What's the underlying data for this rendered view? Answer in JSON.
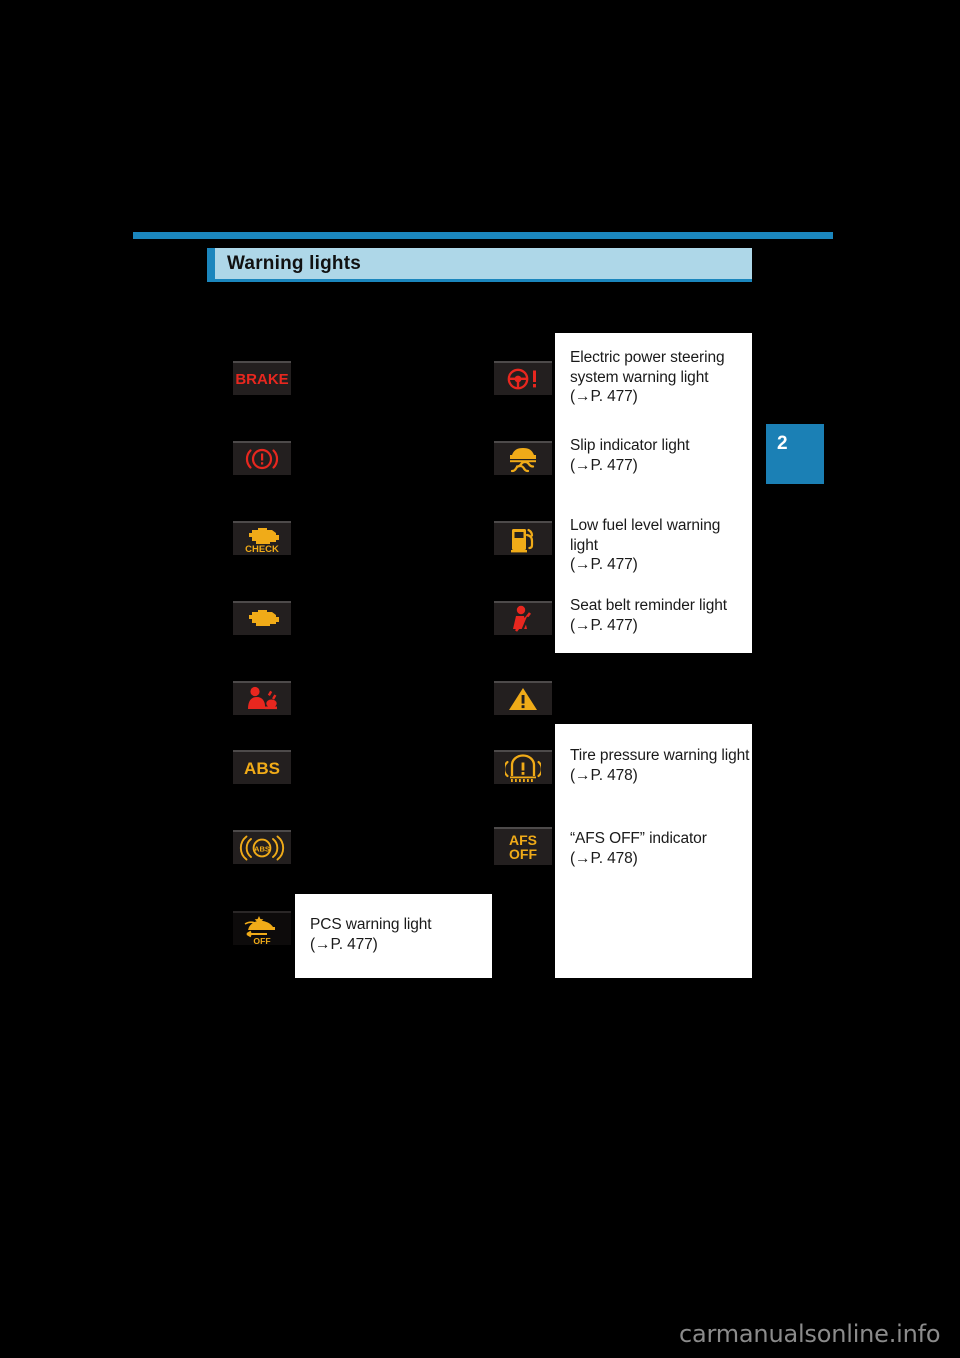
{
  "page": {
    "chapter_number": "2",
    "watermark": "carmanualsonline.info",
    "background_color": "#000000",
    "accent_color": "#1b86bd",
    "header_fill_color": "#aed7e8"
  },
  "section": {
    "title": "Warning lights"
  },
  "left_column": {
    "icons": [
      {
        "id": "brake-warning-light",
        "glyph": "BRAKE",
        "color": "#e8271f"
      },
      {
        "id": "brake-system-warning-light",
        "glyph": "(!)",
        "color": "#e8271f"
      },
      {
        "id": "check-engine-light",
        "glyph": "CHECK",
        "color": "#f0ab18"
      },
      {
        "id": "malfunction-indicator-lamp",
        "glyph": "engine",
        "color": "#f0ab18"
      },
      {
        "id": "srs-airbag-warning-light",
        "glyph": "airbag",
        "color": "#e8271f"
      },
      {
        "id": "abs-warning-light",
        "glyph": "ABS",
        "color": "#f0ab18"
      },
      {
        "id": "brake-assist-warning-light",
        "glyph": "((ABS))",
        "color": "#f0ab18"
      },
      {
        "id": "pcs-warning-light",
        "glyph": "PCS OFF",
        "color": "#f0ab18"
      }
    ]
  },
  "right_column": {
    "icons": [
      {
        "id": "electric-power-steering-warning-light",
        "glyph": "steering-wheel-exclamation",
        "color": "#e8271f"
      },
      {
        "id": "slip-indicator-light",
        "glyph": "car-skid",
        "color": "#f0ab18"
      },
      {
        "id": "low-fuel-level-warning-light",
        "glyph": "fuel-pump",
        "color": "#f0ab18"
      },
      {
        "id": "seat-belt-reminder-light",
        "glyph": "seat-belt",
        "color": "#e8271f"
      },
      {
        "id": "master-warning-light",
        "glyph": "triangle-exclamation",
        "color": "#f0ab18"
      },
      {
        "id": "tire-pressure-warning-light",
        "glyph": "tire-exclamation",
        "color": "#f0ab18"
      },
      {
        "id": "afs-off-indicator",
        "glyph": "AFS OFF",
        "color": "#f0ab18"
      }
    ]
  },
  "descriptions": {
    "eps": {
      "line1": "Electric power steering",
      "line2": "system warning light",
      "ref": "(→P. 477)"
    },
    "slip": {
      "line1": "Slip indicator light",
      "ref": "(→P. 477)"
    },
    "fuel": {
      "line1": "Low fuel level warning light",
      "ref": "(→P. 477)"
    },
    "seatbelt": {
      "line1": "Seat belt reminder light",
      "ref": "(→P. 477)"
    },
    "tire": {
      "line1": "Tire pressure warning light",
      "ref": "(→P. 478)"
    },
    "afs": {
      "line1": "“AFS OFF” indicator",
      "ref": "(→P. 478)"
    },
    "pcs": {
      "line1": "PCS warning light",
      "ref": "(→P. 477)"
    }
  },
  "icon_labels": {
    "brake": "BRAKE",
    "check": "CHECK",
    "abs": "ABS",
    "abs_circled": "ABS",
    "afs_line1": "AFS",
    "afs_line2": "OFF",
    "pcs_off": "OFF"
  }
}
